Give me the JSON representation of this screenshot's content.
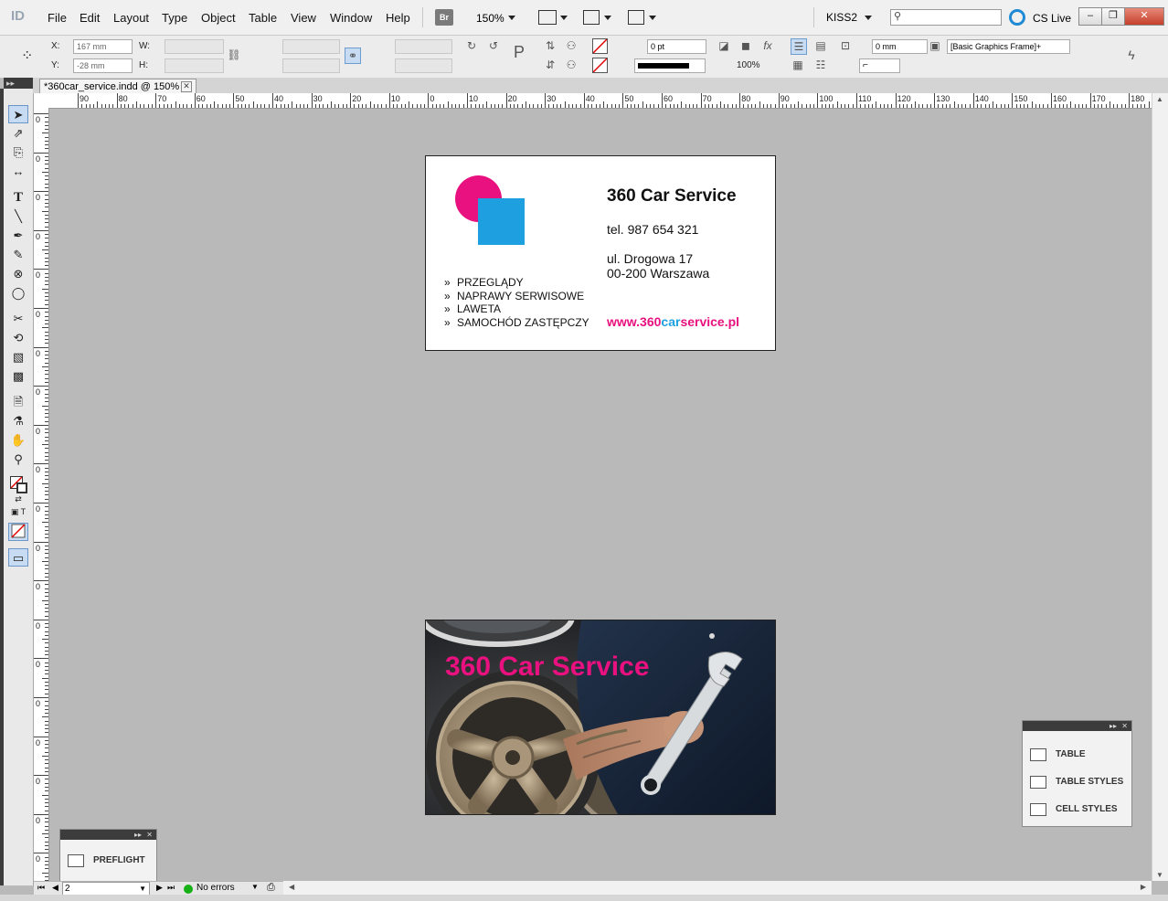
{
  "app": {
    "icon_label": "ID",
    "menu": [
      "File",
      "Edit",
      "Layout",
      "Type",
      "Object",
      "Table",
      "View",
      "Window",
      "Help"
    ],
    "bridge_label": "Br",
    "zoom": "150%",
    "workspace": "KISS2",
    "search_placeholder": "",
    "cs_live": "CS Live",
    "window_buttons": {
      "minimize": "–",
      "restore": "❐",
      "close": "✕"
    }
  },
  "control": {
    "x_label": "X:",
    "x_value": "167 mm",
    "y_label": "Y:",
    "y_value": "-28 mm",
    "w_label": "W:",
    "w_value": "",
    "h_label": "H:",
    "h_value": "",
    "stroke_weight": "0 pt",
    "scale": "100%",
    "offset": "0 mm",
    "object_style": "[Basic Graphics Frame]+"
  },
  "document": {
    "tab_title": "*360car_service.indd @ 150%",
    "tab_close": "✕"
  },
  "rulers": {
    "horizontal": [
      "90",
      "80",
      "70",
      "60",
      "50",
      "40",
      "30",
      "20",
      "10",
      "0",
      "10",
      "20",
      "30",
      "40",
      "50",
      "60",
      "70",
      "80",
      "90",
      "100",
      "110",
      "120",
      "130",
      "140",
      "150",
      "160",
      "170",
      "180"
    ],
    "vertical": [
      "0",
      "0",
      "0",
      "0",
      "0",
      "0",
      "0",
      "0",
      "0",
      "0",
      "0",
      "0",
      "0",
      "0",
      "0",
      "0",
      "0",
      "0",
      "0",
      "0"
    ]
  },
  "card_front": {
    "title": "360 Car Service",
    "phone": "tel. 987 654 321",
    "address1": "ul. Drogowa 17",
    "address2": "00-200 Warszawa",
    "website_pre": "www.360",
    "website_mid": "car",
    "website_post": "service.pl",
    "services": [
      "PRZEGLĄDY",
      "NAPRAWY SERWISOWE",
      "LAWETA",
      "SAMOCHÓD ZASTĘPCZY"
    ],
    "bullet": "»",
    "colors": {
      "magenta": "#e8117f",
      "cyan": "#1e9fe0"
    }
  },
  "card_back": {
    "title": "360 Car Service"
  },
  "panels": {
    "preflight": {
      "label": "PREFLIGHT"
    },
    "table_panel": {
      "items": [
        "TABLE",
        "TABLE STYLES",
        "CELL STYLES"
      ]
    },
    "collapse": "▸▸",
    "close": "✕"
  },
  "status": {
    "page": "2",
    "errors": "No errors",
    "status_color": "#17b017"
  }
}
